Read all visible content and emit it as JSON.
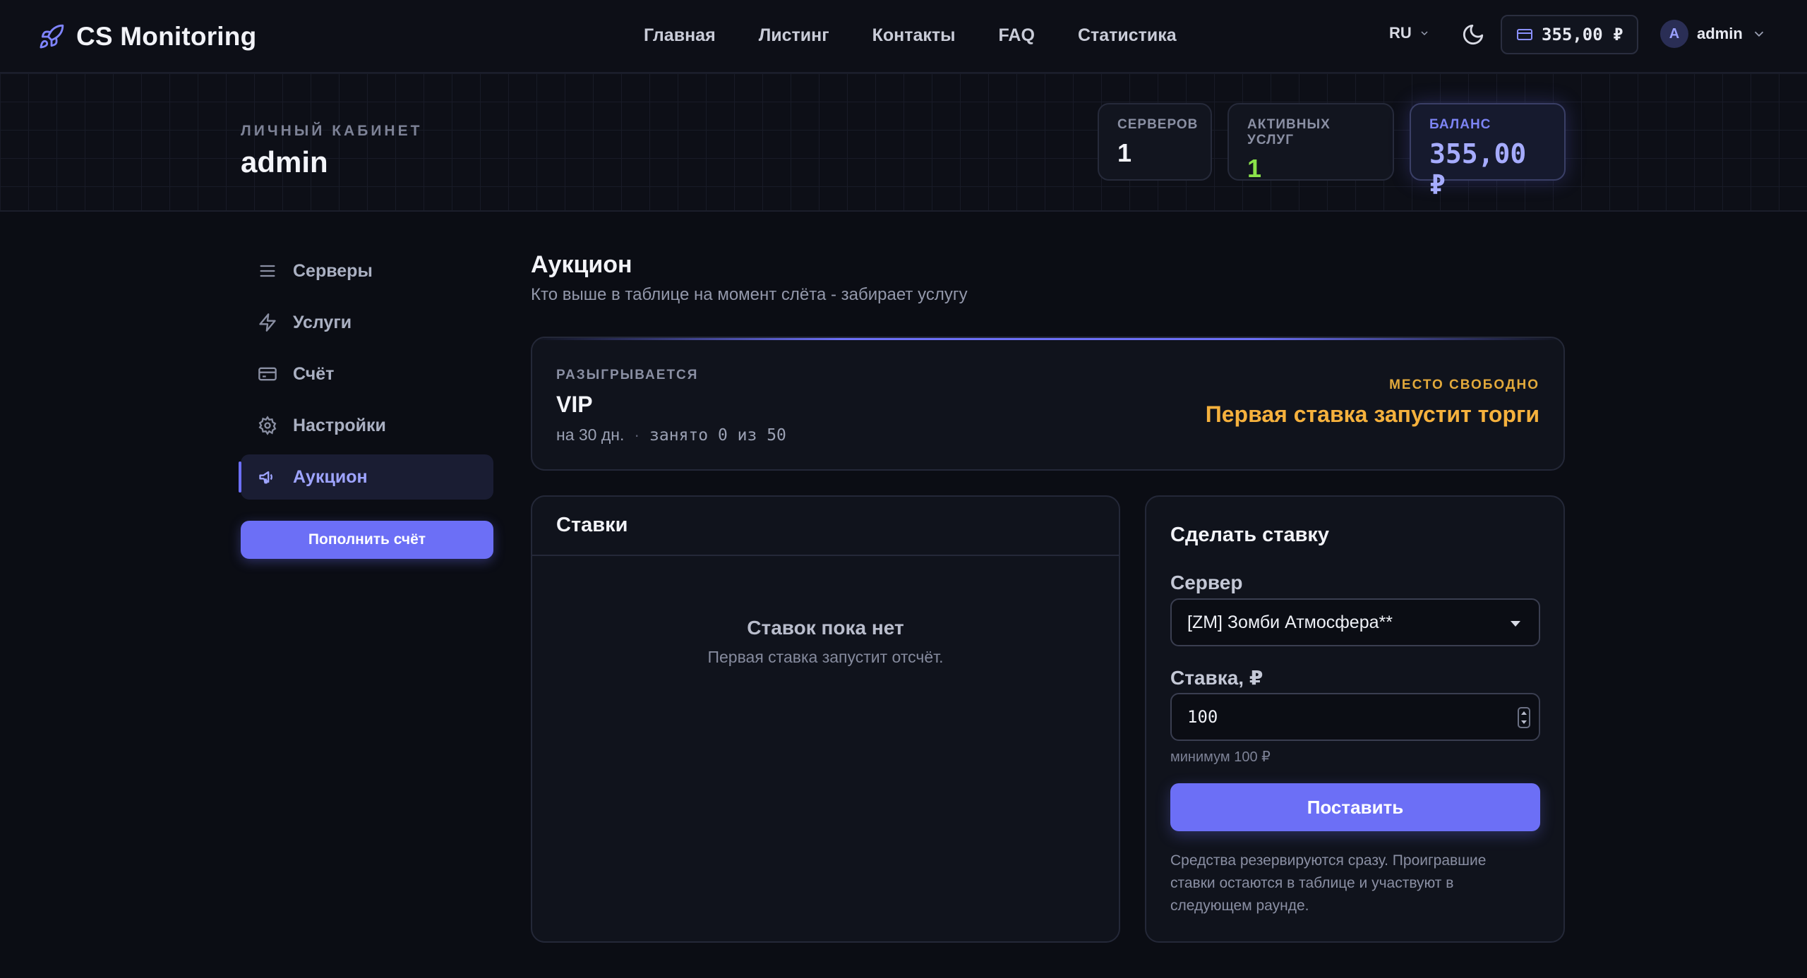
{
  "nav": {
    "brand": "CS Monitoring",
    "links": [
      "Главная",
      "Листинг",
      "Контакты",
      "FAQ",
      "Статистика"
    ],
    "lang": "RU",
    "wallet_balance": "355,00 ₽",
    "avatar_letter": "A",
    "username": "admin"
  },
  "header": {
    "label": "ЛИЧНЫЙ КАБИНЕТ",
    "username": "admin",
    "stats": {
      "servers_label": "СЕРВЕРОВ",
      "servers_value": "1",
      "services_label": "АКТИВНЫХ УСЛУГ",
      "services_value": "1",
      "balance_label": "БАЛАНС",
      "balance_value": "355,00 ₽"
    }
  },
  "sidebar": {
    "items": [
      {
        "label": "Серверы",
        "icon": "list-icon"
      },
      {
        "label": "Услуги",
        "icon": "lightning-icon"
      },
      {
        "label": "Счёт",
        "icon": "card-icon"
      },
      {
        "label": "Настройки",
        "icon": "gear-icon"
      },
      {
        "label": "Аукцион",
        "icon": "megaphone-icon",
        "active": true
      }
    ],
    "topup_label": "Пополнить счёт"
  },
  "main": {
    "title": "Аукцион",
    "subtitle": "Кто выше в таблице на момент слёта - забирает услугу",
    "lot": {
      "label": "РАЗЫГРЫВАЕТСЯ",
      "name": "VIP",
      "duration": "на 30 дн.",
      "separator": "·",
      "occupancy": "занято 0 из 50",
      "status_label": "МЕСТО СВОБОДНО",
      "status_text": "Первая ставка запустит торги"
    },
    "bids": {
      "title": "Ставки",
      "empty_title": "Ставок пока нет",
      "empty_subtitle": "Первая ставка запустит отсчёт."
    },
    "bet_form": {
      "title": "Сделать ставку",
      "server_label": "Сервер",
      "server_value": "[ZM] Зомби Атмосфера**",
      "amount_label": "Ставка, ₽",
      "amount_value": "100",
      "min_hint": "минимум 100 ₽",
      "submit_label": "Поставить",
      "note": "Средства резервируются сразу. Проигравшие ставки остаются в таблице и участвуют в следующем раунде."
    }
  },
  "colors": {
    "accent": "#6c6ff6",
    "background": "#0b0d14",
    "success": "#8be34a",
    "warning": "#f5b13d"
  }
}
